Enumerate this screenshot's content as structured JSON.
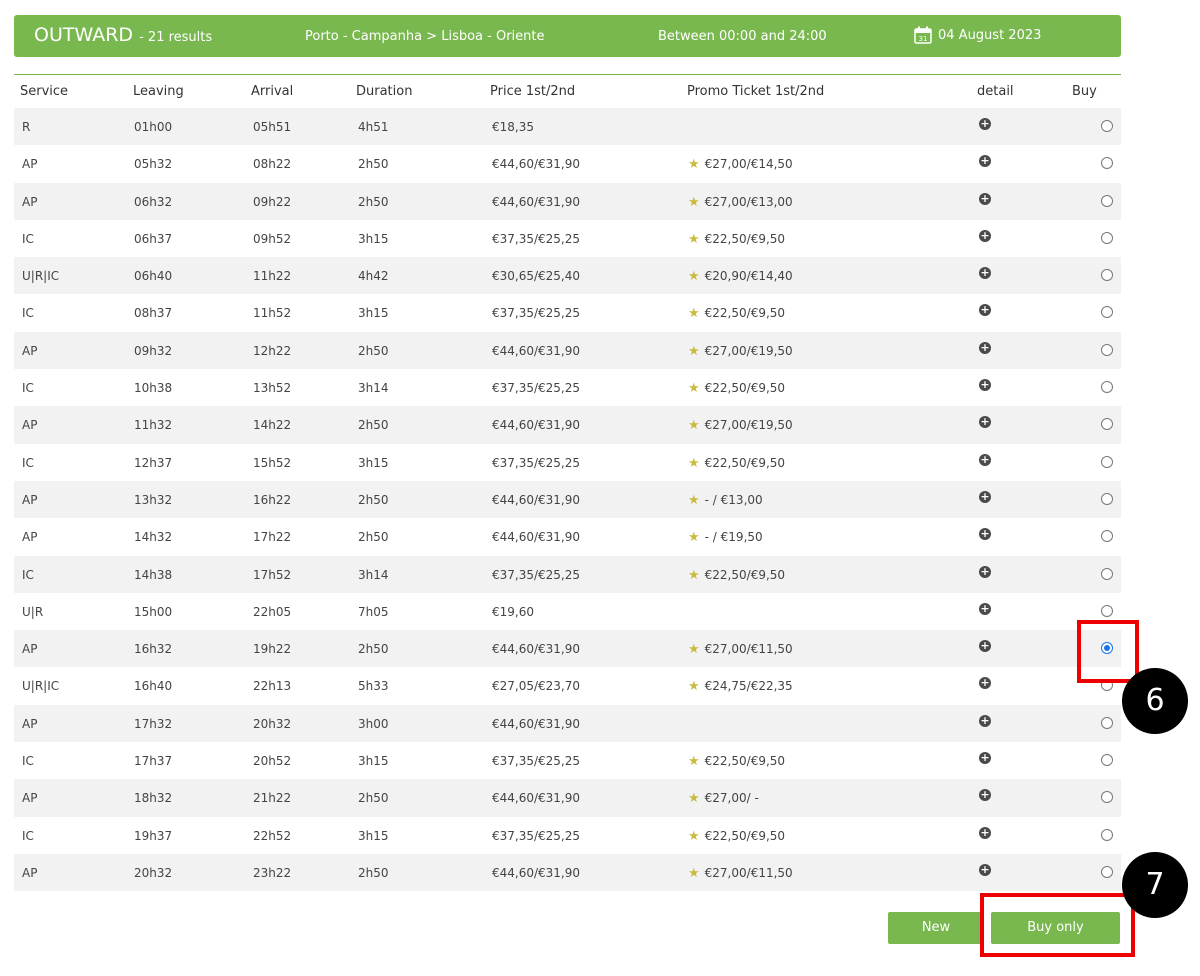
{
  "header": {
    "title": "OUTWARD",
    "count": "- 21 results",
    "route": "Porto - Campanha > Lisboa - Oriente",
    "time_range": "Between 00:00 and 24:00",
    "date": "04 August 2023",
    "date_icon_day": "31"
  },
  "columns": [
    "Service",
    "Leaving",
    "Arrival",
    "Duration",
    "Price 1st/2nd",
    "Promo Ticket 1st/2nd",
    "detail",
    "Buy"
  ],
  "rows": [
    {
      "service": "R",
      "leaving": "01h00",
      "arrival": "05h51",
      "duration": "4h51",
      "price": "€18,35",
      "promo": ""
    },
    {
      "service": "AP",
      "leaving": "05h32",
      "arrival": "08h22",
      "duration": "2h50",
      "price": "€44,60/€31,90",
      "promo": "€27,00/€14,50"
    },
    {
      "service": "AP",
      "leaving": "06h32",
      "arrival": "09h22",
      "duration": "2h50",
      "price": "€44,60/€31,90",
      "promo": "€27,00/€13,00"
    },
    {
      "service": "IC",
      "leaving": "06h37",
      "arrival": "09h52",
      "duration": "3h15",
      "price": "€37,35/€25,25",
      "promo": "€22,50/€9,50"
    },
    {
      "service": "U|R|IC",
      "leaving": "06h40",
      "arrival": "11h22",
      "duration": "4h42",
      "price": "€30,65/€25,40",
      "promo": "€20,90/€14,40"
    },
    {
      "service": "IC",
      "leaving": "08h37",
      "arrival": "11h52",
      "duration": "3h15",
      "price": "€37,35/€25,25",
      "promo": "€22,50/€9,50"
    },
    {
      "service": "AP",
      "leaving": "09h32",
      "arrival": "12h22",
      "duration": "2h50",
      "price": "€44,60/€31,90",
      "promo": "€27,00/€19,50"
    },
    {
      "service": "IC",
      "leaving": "10h38",
      "arrival": "13h52",
      "duration": "3h14",
      "price": "€37,35/€25,25",
      "promo": "€22,50/€9,50"
    },
    {
      "service": "AP",
      "leaving": "11h32",
      "arrival": "14h22",
      "duration": "2h50",
      "price": "€44,60/€31,90",
      "promo": "€27,00/€19,50"
    },
    {
      "service": "IC",
      "leaving": "12h37",
      "arrival": "15h52",
      "duration": "3h15",
      "price": "€37,35/€25,25",
      "promo": "€22,50/€9,50"
    },
    {
      "service": "AP",
      "leaving": "13h32",
      "arrival": "16h22",
      "duration": "2h50",
      "price": "€44,60/€31,90",
      "promo": "- / €13,00"
    },
    {
      "service": "AP",
      "leaving": "14h32",
      "arrival": "17h22",
      "duration": "2h50",
      "price": "€44,60/€31,90",
      "promo": "- / €19,50"
    },
    {
      "service": "IC",
      "leaving": "14h38",
      "arrival": "17h52",
      "duration": "3h14",
      "price": "€37,35/€25,25",
      "promo": "€22,50/€9,50"
    },
    {
      "service": "U|R",
      "leaving": "15h00",
      "arrival": "22h05",
      "duration": "7h05",
      "price": "€19,60",
      "promo": ""
    },
    {
      "service": "AP",
      "leaving": "16h32",
      "arrival": "19h22",
      "duration": "2h50",
      "price": "€44,60/€31,90",
      "promo": "€27,00/€11,50",
      "selected": true
    },
    {
      "service": "U|R|IC",
      "leaving": "16h40",
      "arrival": "22h13",
      "duration": "5h33",
      "price": "€27,05/€23,70",
      "promo": "€24,75/€22,35"
    },
    {
      "service": "AP",
      "leaving": "17h32",
      "arrival": "20h32",
      "duration": "3h00",
      "price": "€44,60/€31,90",
      "promo": ""
    },
    {
      "service": "IC",
      "leaving": "17h37",
      "arrival": "20h52",
      "duration": "3h15",
      "price": "€37,35/€25,25",
      "promo": "€22,50/€9,50"
    },
    {
      "service": "AP",
      "leaving": "18h32",
      "arrival": "21h22",
      "duration": "2h50",
      "price": "€44,60/€31,90",
      "promo": "€27,00/ -"
    },
    {
      "service": "IC",
      "leaving": "19h37",
      "arrival": "22h52",
      "duration": "3h15",
      "price": "€37,35/€25,25",
      "promo": "€22,50/€9,50"
    },
    {
      "service": "AP",
      "leaving": "20h32",
      "arrival": "23h22",
      "duration": "2h50",
      "price": "€44,60/€31,90",
      "promo": "€27,00/€11,50"
    }
  ],
  "buttons": {
    "new_search": "New search",
    "buy_outward": "Buy only outward"
  },
  "annotations": [
    "6",
    "7"
  ],
  "colors": {
    "brand_green": "#78b84e",
    "highlight": "#e00000",
    "radio_checked": "#1a73e8",
    "star": "#c9bb3f"
  },
  "icons": {
    "detail": "plus-circle-icon",
    "promo": "star-icon",
    "date": "calendar-icon"
  }
}
